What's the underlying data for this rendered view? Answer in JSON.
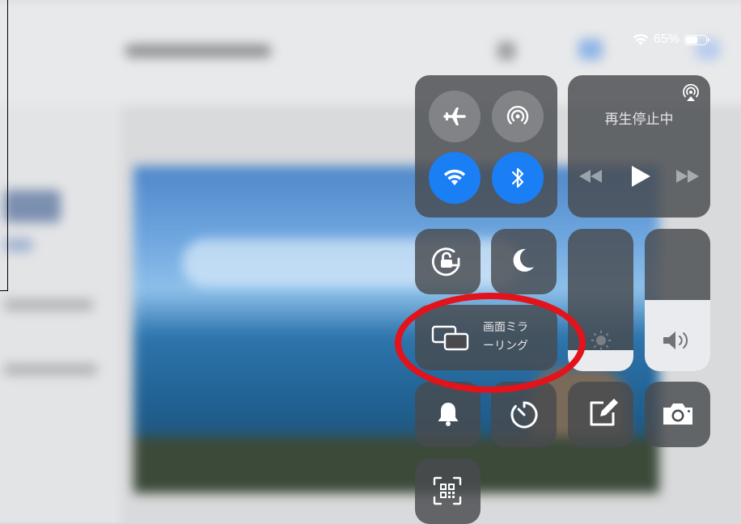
{
  "status_bar": {
    "battery_percent": "65%",
    "battery_level": 0.65,
    "wifi_icon": "wifi-icon"
  },
  "connectivity": {
    "airplane": {
      "icon": "airplane-icon",
      "active": false
    },
    "airdrop": {
      "icon": "airdrop-icon",
      "active": false
    },
    "wifi": {
      "icon": "wifi-icon",
      "active": true
    },
    "bluetooth": {
      "icon": "bluetooth-icon",
      "active": true
    }
  },
  "now_playing": {
    "status_text": "再生停止中",
    "airplay_icon": "airplay-icon",
    "controls": [
      "rewind-icon",
      "play-icon",
      "fast-forward-icon"
    ]
  },
  "toggles": {
    "rotation_lock": "rotation-lock-icon",
    "do_not_disturb": "moon-icon"
  },
  "screen_mirroring": {
    "label": "画面ミラーリング",
    "label_line1": "画面ミラ",
    "label_line2": "ーリング",
    "icon": "screen-mirroring-icon"
  },
  "sliders": {
    "brightness": {
      "icon": "sun-icon",
      "level": 0.15
    },
    "volume": {
      "icon": "speaker-icon",
      "level": 0.5
    }
  },
  "shortcuts": [
    "bell-icon",
    "timer-icon",
    "notes-icon",
    "camera-icon",
    "qr-code-icon"
  ],
  "annotation": {
    "highlight_color": "#e2131b"
  },
  "colors": {
    "accent_blue": "#1a7ff5",
    "tile_bg": "#484a4e"
  }
}
